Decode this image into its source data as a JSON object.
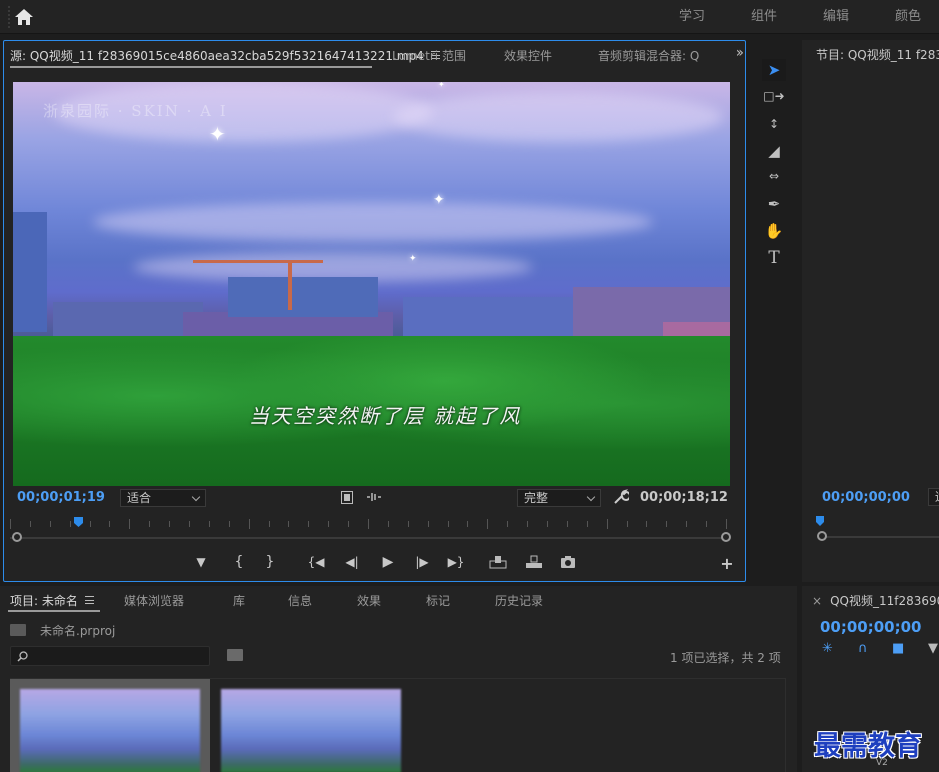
{
  "workspace": {
    "tabs": [
      "学习",
      "组件",
      "编辑",
      "颜色"
    ]
  },
  "source_panel": {
    "tabs": [
      {
        "label": "源: QQ视频_11 f28369015ce4860aea32cba529f5321647413221.mp4",
        "active": true
      },
      {
        "label": "Lumetri 范围",
        "active": false
      },
      {
        "label": "效果控件",
        "active": false
      },
      {
        "label": "音频剪辑混合器: Q",
        "active": false
      }
    ],
    "video": {
      "subtitle": "当天空突然断了层 就起了风",
      "watermark": "浙泉园际 · SKIN · A I"
    },
    "current_time": "00;00;01;19",
    "zoom": "适合",
    "quality": "完整",
    "duration": "00;00;18;12",
    "playhead_fraction": 0.09
  },
  "program_panel": {
    "title": "节目: QQ视频_11 f28369015",
    "current_time": "00;00;00;00",
    "zoom": "适"
  },
  "project_panel": {
    "tabs": [
      {
        "label": "项目: 未命名",
        "active": true
      },
      {
        "label": "媒体浏览器",
        "active": false
      },
      {
        "label": "库",
        "active": false
      },
      {
        "label": "信息",
        "active": false
      },
      {
        "label": "效果",
        "active": false
      },
      {
        "label": "标记",
        "active": false
      },
      {
        "label": "历史记录",
        "active": false
      }
    ],
    "project_file": "未命名.prproj",
    "selection_status": "1 项已选择，共 2 项"
  },
  "timeline_panel": {
    "title": "QQ视频_11f28369015",
    "current_time": "00;00;00;00",
    "track": "V2"
  },
  "brand_watermark": "最需教育",
  "colors": {
    "accent_blue": "#2d8ceb",
    "timecode_blue": "#4d9ef5",
    "panel_bg": "#232323"
  }
}
